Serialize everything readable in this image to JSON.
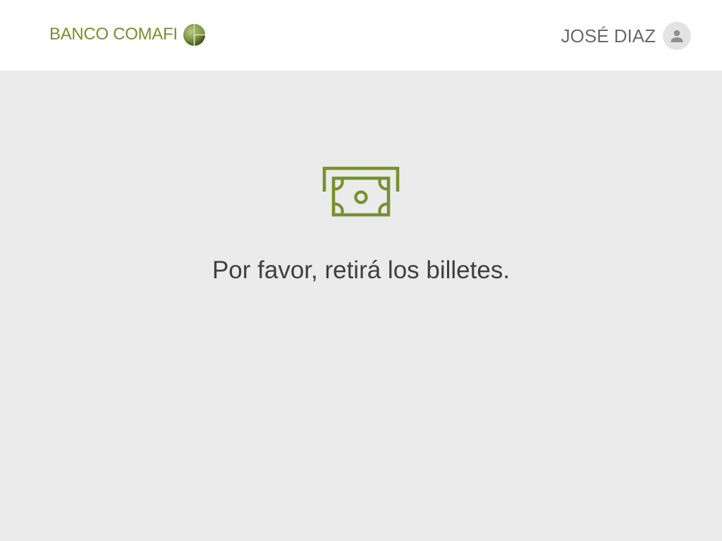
{
  "header": {
    "brand": "BANCO COMAFI",
    "user_name": "JOSÉ DIAZ"
  },
  "main": {
    "message": "Por favor, retirá los billetes."
  },
  "icons": {
    "brand_logo": "globe-logo-icon",
    "avatar": "user-avatar-icon",
    "cash": "cash-dispense-icon"
  },
  "colors": {
    "brand_green": "#76902f",
    "background": "#ebebeb",
    "header_background": "#ffffff",
    "text": "#3f3f3f"
  }
}
